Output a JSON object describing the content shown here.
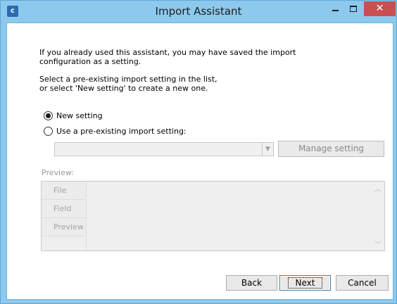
{
  "window": {
    "title": "Import Assistant",
    "icon_letter": "c"
  },
  "intro": {
    "line1": "If you already used this assistant, you may have saved the import",
    "line2": "configuration as a setting.",
    "line3": "Select a pre-existing import setting in the list,",
    "line4": "or select 'New setting' to create a new one."
  },
  "options": {
    "new_setting": "New setting",
    "existing_setting": "Use a pre-existing import setting:",
    "selected": "new_setting"
  },
  "combo": {
    "value": ""
  },
  "buttons": {
    "manage": "Manage setting",
    "back": "Back",
    "next": "Next",
    "cancel": "Cancel"
  },
  "preview": {
    "label": "Preview:",
    "rows": [
      "File",
      "Field",
      "Preview"
    ]
  }
}
